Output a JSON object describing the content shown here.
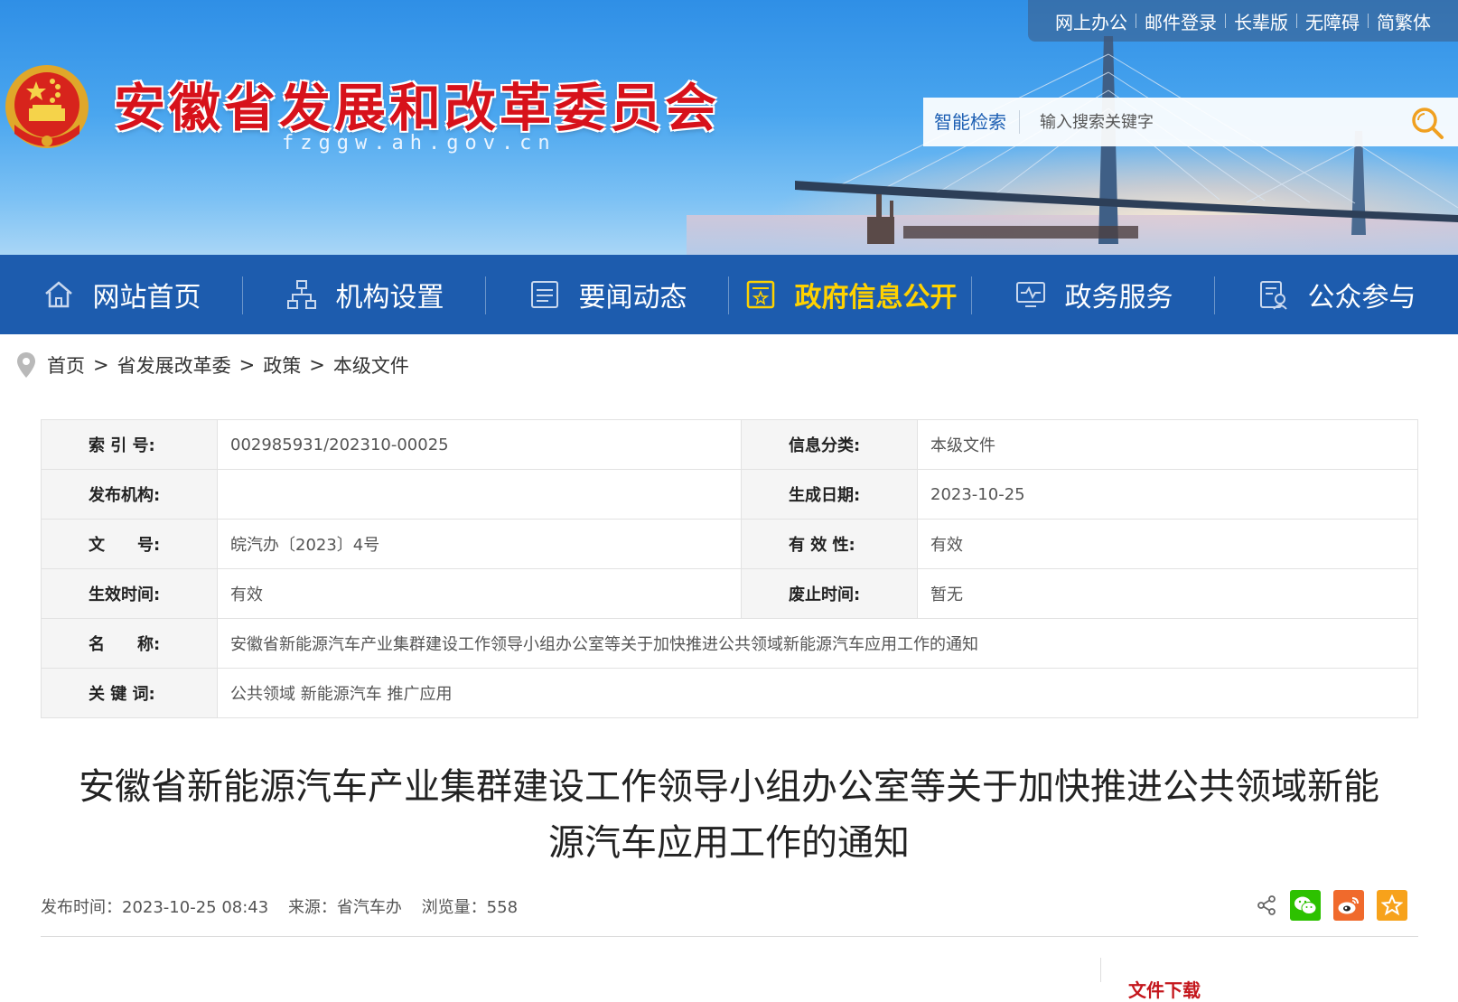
{
  "header": {
    "site_title": "安徽省发展和改革委员会",
    "site_domain": "fzggw.ah.gov.cn",
    "top_links": [
      "网上办公",
      "邮件登录",
      "长辈版",
      "无障碍",
      "简繁体"
    ],
    "search": {
      "label": "智能检索",
      "placeholder": "输入搜索关键字"
    }
  },
  "nav": {
    "items": [
      {
        "label": "网站首页",
        "icon": "home-icon"
      },
      {
        "label": "机构设置",
        "icon": "org-chart-icon"
      },
      {
        "label": "要闻动态",
        "icon": "news-icon"
      },
      {
        "label": "政府信息公开",
        "icon": "info-disclosure-icon",
        "active": true
      },
      {
        "label": "政务服务",
        "icon": "service-monitor-icon"
      },
      {
        "label": "公众参与",
        "icon": "participation-icon"
      }
    ],
    "active_color": "#ffd200",
    "bg_color": "#1d5cae"
  },
  "breadcrumb": {
    "items": [
      "首页",
      "省发展改革委",
      "政策",
      "本级文件"
    ],
    "separator": ">"
  },
  "info_table": {
    "index_no_label": "索 引 号:",
    "index_no": "002985931/202310-00025",
    "category_label": "信息分类:",
    "category": "本级文件",
    "publisher_label": "发布机构:",
    "publisher": "",
    "created_label": "生成日期:",
    "created": "2023-10-25",
    "doc_no_label": "文　　号:",
    "doc_no": "皖汽办〔2023〕4号",
    "validity_label": "有 效 性:",
    "validity": "有效",
    "effective_label": "生效时间:",
    "effective": "有效",
    "expire_label": "废止时间:",
    "expire": "暂无",
    "name_label": "名　　称:",
    "name": "安徽省新能源汽车产业集群建设工作领导小组办公室等关于加快推进公共领域新能源汽车应用工作的通知",
    "keywords_label": "关 键 词:",
    "keywords": "公共领域 新能源汽车 推广应用"
  },
  "article": {
    "title": "安徽省新能源汽车产业集群建设工作领导小组办公室等关于加快推进公共领域新能源汽车应用工作的通知",
    "publish_time": "发布时间：2023-10-25 08:43",
    "source": "来源：省汽车办",
    "views": "浏览量：558"
  },
  "share_icons": [
    "share-icon",
    "wechat-icon",
    "weibo-icon",
    "favorite-icon"
  ],
  "attachments": {
    "title": "文件下载"
  }
}
